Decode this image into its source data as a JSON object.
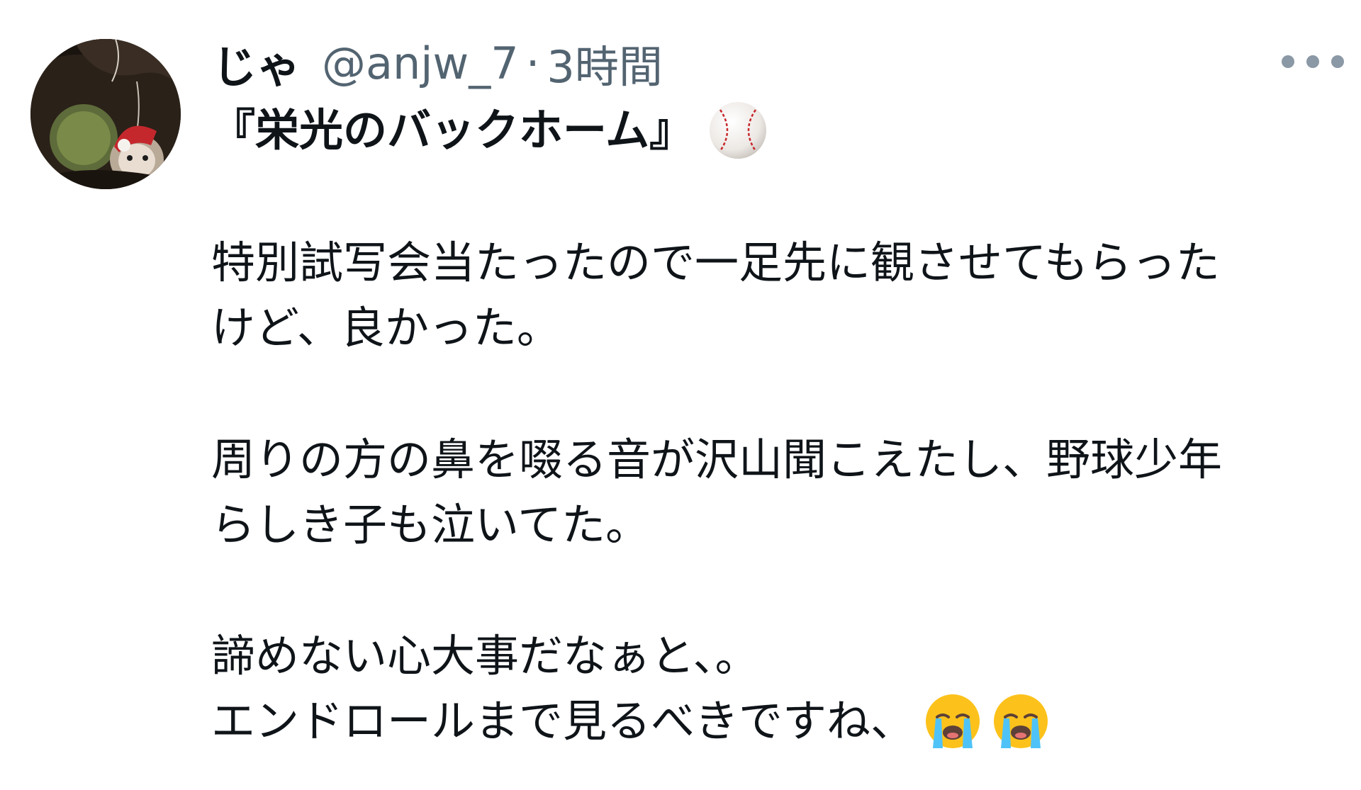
{
  "user": {
    "display_name": "じゃ",
    "handle": "@anjw_7",
    "separator": "·",
    "time": "3時間"
  },
  "tweet": {
    "title": "『栄光のバックホーム』",
    "title_emoji": "baseball-emoji",
    "lines": {
      "l1": "特別試写会当たったので一足先に観させてもらった",
      "l2": "けど、良かった。",
      "l3": "周りの方の鼻を啜る音が沢山聞こえたし、野球少年",
      "l4": "らしき子も泣いてた。",
      "l5": "諦めない心大事だなぁと、。",
      "l6": "エンドロールまで見るべきですね、"
    },
    "end_emojis": [
      "loudly-crying-face-emoji",
      "loudly-crying-face-emoji"
    ]
  },
  "icons": {
    "more": "more-horizontal-icon",
    "avatar": "avatar"
  },
  "colors": {
    "text": "#0f1419",
    "secondary": "#536471"
  }
}
